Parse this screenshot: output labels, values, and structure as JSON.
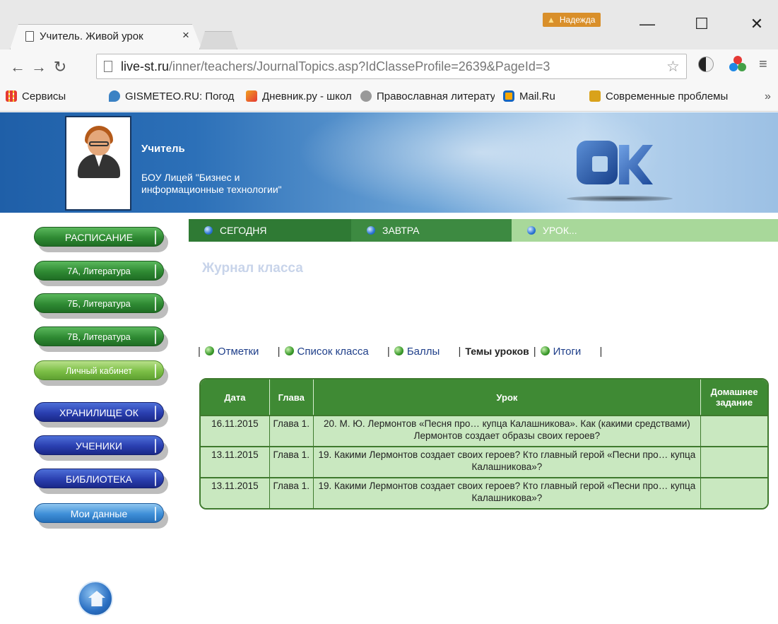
{
  "browser": {
    "tab_title": "Учитель. Живой урок",
    "tab_close": "×",
    "profile_badge": "Надежда",
    "url_host": "live-st.ru",
    "url_path": "/inner/teachers/JournalTopics.asp?IdClasseProfile=2639&PageId=3",
    "window_controls": {
      "minimize": "—",
      "maximize": "☐",
      "close": "✕"
    },
    "bookmarks": [
      {
        "label": "Сервисы",
        "icon": "apps-grid-icon",
        "color": "#e53935"
      },
      {
        "label": "GISMETEO.RU: Погода",
        "icon": "gismeteo-icon",
        "color": "#3b82c4"
      },
      {
        "label": "Дневник.ру - школа",
        "icon": "dnevnik-icon",
        "color": "#f0a020"
      },
      {
        "label": "Православная литература",
        "icon": "library-icon",
        "color": "#777777"
      },
      {
        "label": "Mail.Ru",
        "icon": "mailru-icon",
        "color": "#1565c0"
      },
      {
        "label": "Современные проблемы",
        "icon": "sovrem-icon",
        "color": "#d9a21b"
      }
    ],
    "bookmarks_more": "»"
  },
  "header": {
    "role": "Учитель",
    "school": "БОУ Лицей \"Бизнес и информационные технологии\""
  },
  "sidebar": {
    "items": [
      {
        "label": "РАСПИСАНИЕ",
        "style": "green"
      },
      {
        "label": "7А, Литература",
        "style": "green"
      },
      {
        "label": "7Б, Литература",
        "style": "green"
      },
      {
        "label": "7В, Литература",
        "style": "green"
      },
      {
        "label": "Личный кабинет",
        "style": "lightgreen"
      },
      {
        "label": "ХРАНИЛИЩЕ ОК",
        "style": "blue"
      },
      {
        "label": "УЧЕНИКИ",
        "style": "blue"
      },
      {
        "label": "БИБЛИОТЕКА",
        "style": "blue"
      },
      {
        "label": "Мои данные",
        "style": "sky"
      }
    ]
  },
  "topnav": {
    "items": [
      "СЕГОДНЯ",
      "ЗАВТРА",
      "УРОК..."
    ]
  },
  "journal": {
    "title": "Журнал класса",
    "tabs": [
      "Отметки",
      "Список класса",
      "Баллы",
      "Темы уроков",
      "Итоги"
    ],
    "current_tab": "Темы уроков",
    "columns": [
      "Дата",
      "Глава",
      "Урок",
      "Домашнее задание"
    ],
    "rows": [
      {
        "date": "16.11.2015",
        "chapter": "Глава 1.",
        "lesson": "20. М. Ю. Лермонтов «Песня про… купца Калашникова». Как (какими средствами) Лермонтов создает образы своих героев?",
        "homework": ""
      },
      {
        "date": "13.11.2015",
        "chapter": "Глава 1.",
        "lesson": "19. Какими Лермонтов создает своих героев? Кто главный герой «Песни про… купца Калашникова»?",
        "homework": ""
      },
      {
        "date": "13.11.2015",
        "chapter": "Глава 1.",
        "lesson": "19. Какими Лермонтов создает своих героев? Кто главный герой «Песни про… купца Калашникова»?",
        "homework": ""
      }
    ]
  },
  "colors": {
    "nav_dark_green": "#2f7a34",
    "nav_light_green": "#a8d89a",
    "table_header": "#3f8a34",
    "table_cell": "#c9e8c0",
    "header_blue": "#2c70b8"
  }
}
